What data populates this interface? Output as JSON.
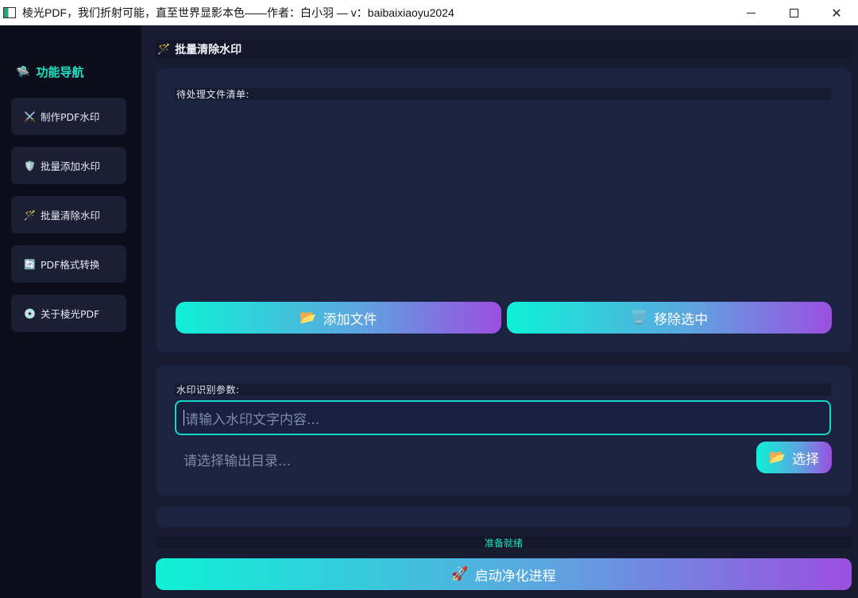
{
  "window": {
    "title": "棱光PDF，我们折射可能，直至世界显影本色——作者：白小羽 — v：baibaixiaoyu2024",
    "minimize": "minimize",
    "maximize": "maximize",
    "close": "✕"
  },
  "sidebar": {
    "header": {
      "icon": "🛸",
      "label": "功能导航"
    },
    "items": [
      {
        "icon": "⚔️",
        "label": "制作PDF水印"
      },
      {
        "icon": "🛡️",
        "label": "批量添加水印"
      },
      {
        "icon": "🪄",
        "label": "批量清除水印"
      },
      {
        "icon": "🔄",
        "label": "PDF格式转换"
      },
      {
        "icon": "💿",
        "label": "关于棱光PDF"
      }
    ]
  },
  "main": {
    "page_title": {
      "icon": "🪄",
      "label": "批量清除水印"
    },
    "file_list": {
      "label": "待处理文件清单:",
      "add_button": {
        "icon": "📂",
        "label": "添加文件"
      },
      "remove_button": {
        "icon": "🗑️",
        "label": "移除选中"
      }
    },
    "params": {
      "label": "水印识别参数:",
      "watermark_placeholder": "请输入水印文字内容...",
      "output_placeholder": "请选择输出目录...",
      "choose_button": {
        "icon": "📂",
        "label": "选择"
      }
    },
    "status": "准备就绪",
    "start_button": {
      "icon": "🚀",
      "label": "启动净化进程"
    }
  },
  "colors": {
    "accent": "#20e3c4",
    "gradient_start": "#0ef1d6",
    "gradient_end": "#9b4fe0",
    "sidebar_bg": "#0b0d1a",
    "main_bg": "#171c33"
  },
  "icons": {
    "app": "app-icon",
    "minimize": "minimize-icon",
    "maximize": "maximize-icon",
    "close": "close-icon",
    "cursor": "text-cursor-icon"
  }
}
